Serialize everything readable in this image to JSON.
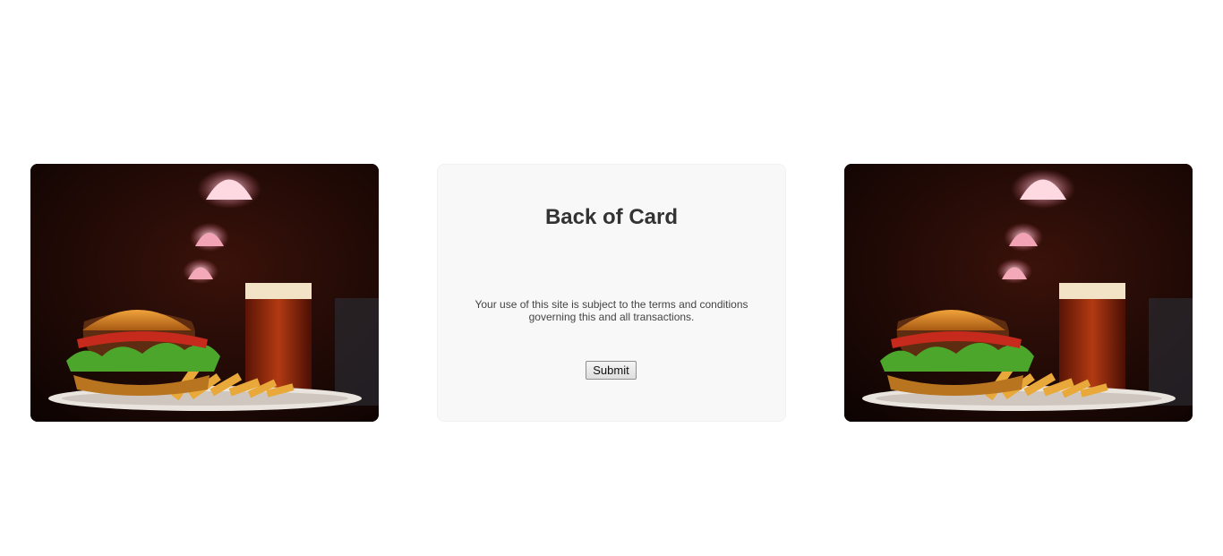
{
  "cards": {
    "left_image": {
      "description_icon": "burger-photo-icon"
    },
    "back": {
      "title": "Back of Card",
      "terms_text": "Your use of this site is subject to the terms and conditions governing this and all transactions.",
      "submit_label": "Submit"
    },
    "right_image": {
      "description_icon": "burger-photo-icon"
    }
  },
  "colors": {
    "card_background": "#f8f8f8",
    "title": "#333333",
    "text": "#444444"
  }
}
